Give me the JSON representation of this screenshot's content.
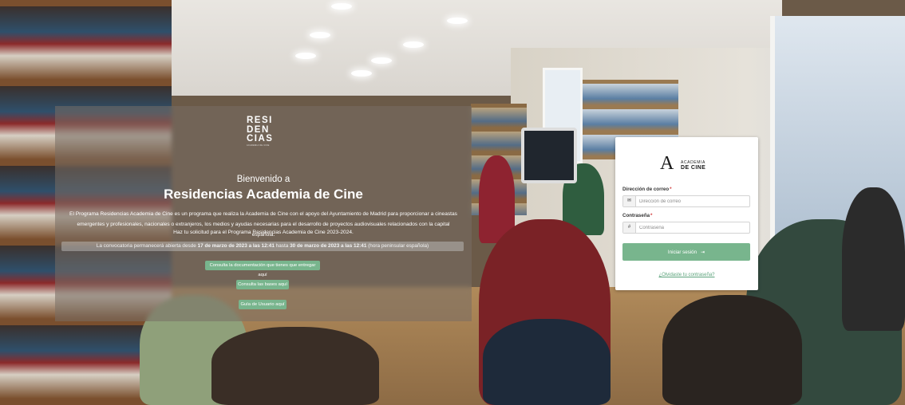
{
  "info_panel": {
    "logo_lines": [
      "RESI",
      "DEN",
      "CIAS"
    ],
    "logo_tagline": "ACADEMIA DE CINE",
    "welcome": "Bienvenido a",
    "headline": "Residencias Academia de Cine",
    "description": "El Programa Residencias Academia de Cine es un programa que realiza la Academia de Cine con el apoyo del Ayuntamiento de Madrid para proporcionar a cineastas emergentes y profesionales, nacionales o extranjeros, los medios y ayudas necesarias para el desarrollo de proyectos audiovisuales relacionados con la capital española.",
    "solicitud": "Haz tu solicitud para el Programa Residencias Academia de Cine 2023-2024.",
    "deadline": {
      "prefix": "La convocatoria permanecerá abierta desde ",
      "start": "17 de marzo de 2023 a las 12:41",
      "middle": " hasta ",
      "end": "30 de marzo de 2023 a las 12:41",
      "suffix": " (hora peninsular española)"
    },
    "buttons": {
      "docs": "Consulta la documentación que tienes que entregar aquí",
      "bases": "Consulta las bases aquí",
      "guide": "Guía de Usuario aquí"
    }
  },
  "login": {
    "logo_big": "A",
    "logo_top": "ACADEMIA",
    "logo_bottom": "DE CINE",
    "email_label": "Dirección de correo",
    "email_placeholder": "Dirección de correo",
    "email_icon": "✉",
    "password_label": "Contraseña",
    "password_placeholder": "Contraseña",
    "password_icon": "#",
    "required_mark": "*",
    "submit_label": "Iniciar sesión",
    "submit_icon": "⇥",
    "forgot_label": "¿Olvidaste tu contraseña?"
  },
  "colors": {
    "accent_green": "#78b58d",
    "link_green": "#5aa27a",
    "required_red": "#d23b3b"
  }
}
